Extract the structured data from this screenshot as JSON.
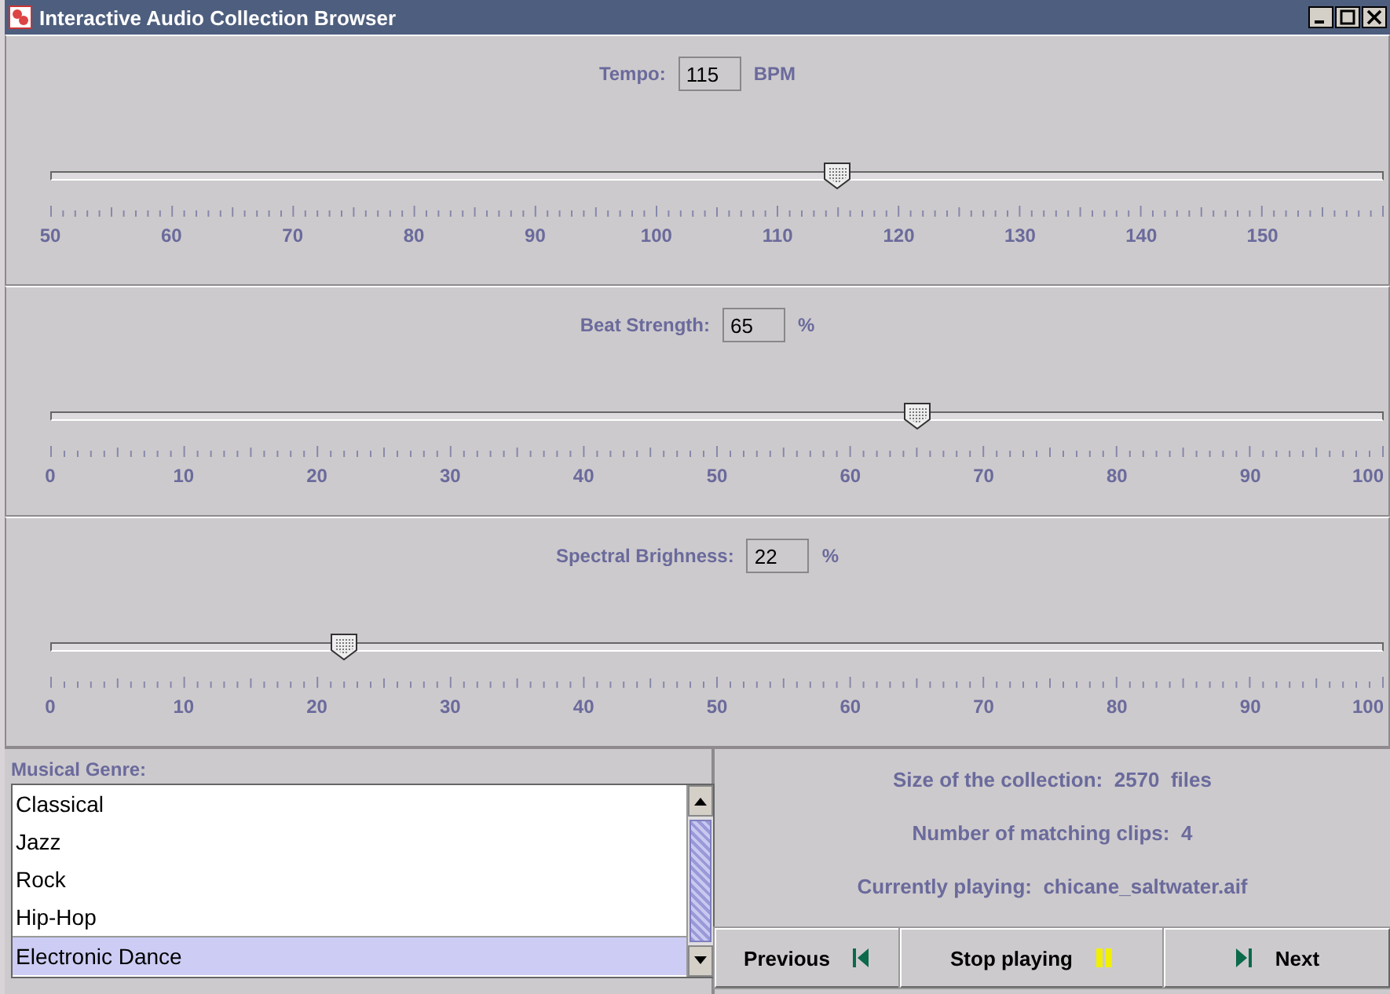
{
  "window": {
    "title": "Interactive Audio Collection Browser"
  },
  "sliders": [
    {
      "label": "Tempo:",
      "value": "115",
      "unit": "BPM",
      "level": 0.59,
      "tick_labels": [
        "50",
        "60",
        "70",
        "80",
        "90",
        "100",
        "110",
        "120",
        "130",
        "140",
        "150"
      ]
    },
    {
      "label": "Beat Strength:",
      "value": "65",
      "unit": "%",
      "level": 0.65,
      "tick_labels": [
        "0",
        "10",
        "20",
        "30",
        "40",
        "50",
        "60",
        "70",
        "80",
        "90",
        "100"
      ]
    },
    {
      "label": "Spectral Brighness:",
      "value": "22",
      "unit": "%",
      "level": 0.22,
      "tick_labels": [
        "0",
        "10",
        "20",
        "30",
        "40",
        "50",
        "60",
        "70",
        "80",
        "90",
        "100"
      ]
    }
  ],
  "genre_list": {
    "label": "Musical Genre:",
    "items": [
      {
        "text": "Classical",
        "selected": false
      },
      {
        "text": "Jazz",
        "selected": false
      },
      {
        "text": "Rock",
        "selected": false
      },
      {
        "text": "Hip-Hop",
        "selected": false
      },
      {
        "text": "Electronic Dance",
        "selected": true
      }
    ]
  },
  "info_lines": [
    "Size of the collection:  2570  files",
    "Number of matching clips:  4",
    "Currently playing:  chicane_saltwater.aif"
  ],
  "buttons": [
    {
      "label": "Previous",
      "kind": "skip-back"
    },
    {
      "label": "Stop playing",
      "kind": "pause"
    },
    {
      "label": "Next",
      "kind": "skip-forward"
    }
  ]
}
